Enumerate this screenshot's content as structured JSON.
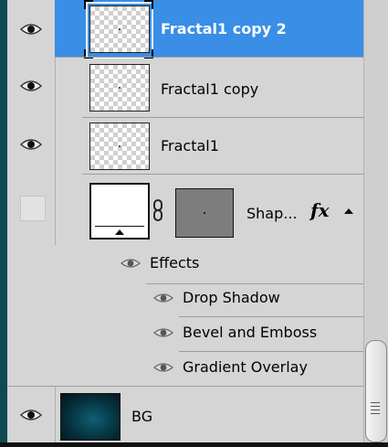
{
  "layers": [
    {
      "name": "Fractal1 copy 2",
      "selected": true,
      "visible": true
    },
    {
      "name": "Fractal1 copy",
      "selected": false,
      "visible": true
    },
    {
      "name": "Fractal1",
      "selected": false,
      "visible": true
    },
    {
      "name": "Shap...",
      "selected": false,
      "visible": false,
      "fx": "fx"
    },
    {
      "name": "BG",
      "selected": false,
      "visible": true
    }
  ],
  "effects": {
    "header": "Effects",
    "items": [
      "Drop Shadow",
      "Bevel and Emboss",
      "Gradient Overlay"
    ]
  },
  "colors": {
    "selection": "#3a8ee6",
    "panel": "#d5d5d5",
    "canvas_edge": "#0d4a55"
  },
  "icons": [
    "eye-icon",
    "link-chain-icon",
    "fx-icon",
    "collapse-arrow-icon",
    "scrollbar-grip-icon"
  ]
}
